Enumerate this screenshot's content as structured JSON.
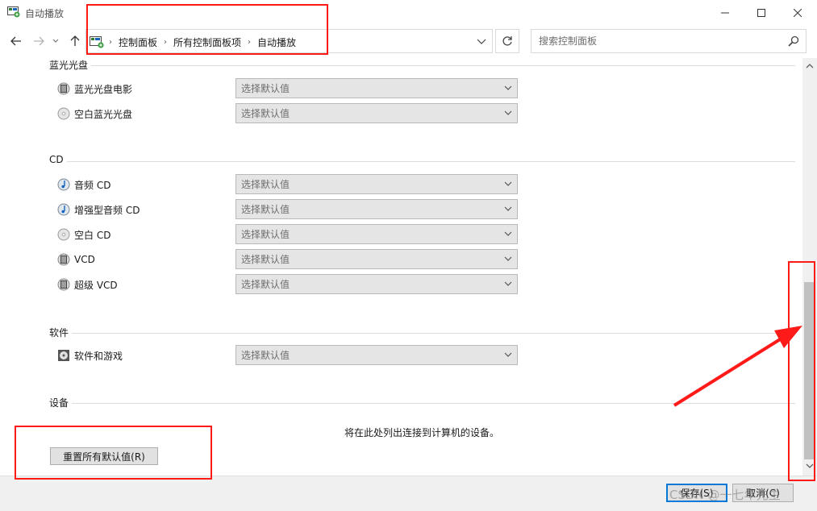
{
  "window": {
    "title": "自动播放"
  },
  "address": {
    "crumbs": [
      "控制面板",
      "所有控制面板项",
      "自动播放"
    ]
  },
  "search": {
    "placeholder": "搜索控制面板"
  },
  "sections": {
    "bluray": {
      "title": "蓝光光盘",
      "items": [
        {
          "label": "蓝光光盘电影",
          "value": "选择默认值",
          "icon": "film-disc-icon"
        },
        {
          "label": "空白蓝光光盘",
          "value": "选择默认值",
          "icon": "blank-disc-icon"
        }
      ]
    },
    "cd": {
      "title": "CD",
      "items": [
        {
          "label": "音频 CD",
          "value": "选择默认值",
          "icon": "audio-cd-icon"
        },
        {
          "label": "增强型音频 CD",
          "value": "选择默认值",
          "icon": "audio-cd-icon"
        },
        {
          "label": "空白 CD",
          "value": "选择默认值",
          "icon": "blank-disc-icon"
        },
        {
          "label": "VCD",
          "value": "选择默认值",
          "icon": "film-disc-icon"
        },
        {
          "label": "超级 VCD",
          "value": "选择默认值",
          "icon": "film-disc-icon"
        }
      ]
    },
    "software": {
      "title": "软件",
      "items": [
        {
          "label": "软件和游戏",
          "value": "选择默认值",
          "icon": "software-disc-icon"
        }
      ]
    },
    "devices": {
      "title": "设备",
      "note": "将在此处列出连接到计算机的设备。"
    }
  },
  "buttons": {
    "reset": "重置所有默认值(R)",
    "save": "保存(S)",
    "cancel": "取消(C)"
  },
  "watermark": "CSDN @一七年先生",
  "colors": {
    "annotation": "#ff1a1a",
    "focus": "#0078d7"
  }
}
